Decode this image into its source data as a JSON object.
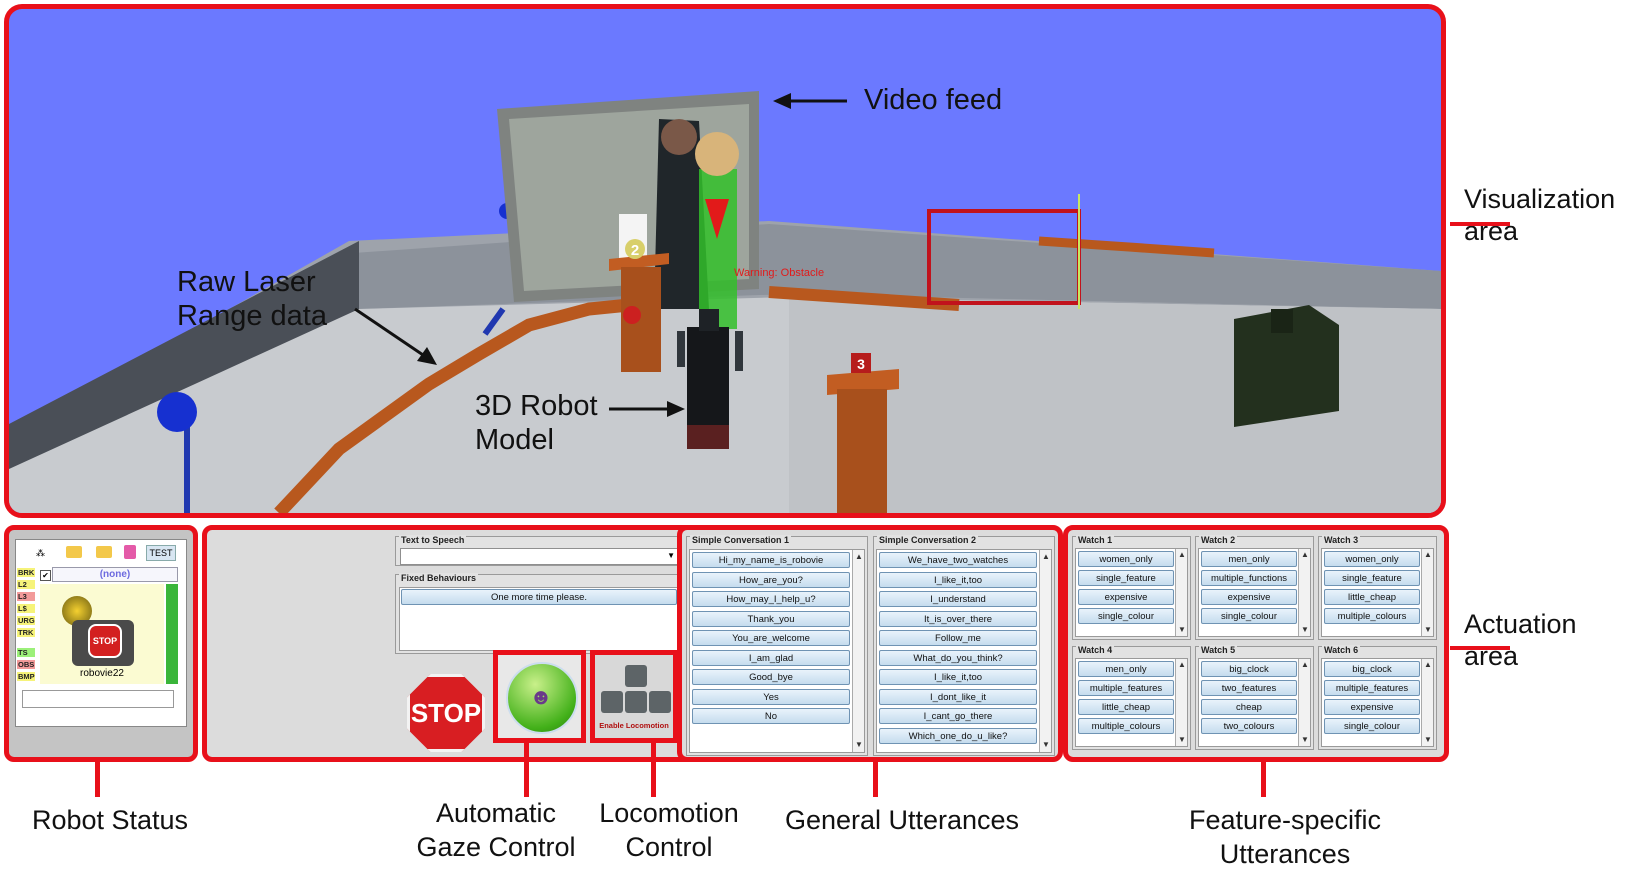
{
  "annotations": {
    "video_feed": "Video feed",
    "laser": [
      "Raw Laser",
      "Range data"
    ],
    "robot_model": [
      "3D Robot",
      "Model"
    ],
    "visualization": [
      "Visualization",
      "area"
    ],
    "actuation": [
      "Actuation",
      "area"
    ],
    "warning": "Warning: Obstacle",
    "marker_2": "2",
    "marker_3": "3"
  },
  "bottom_labels": {
    "robot_status": "Robot Status",
    "gaze": [
      "Automatic",
      "Gaze Control"
    ],
    "locomotion": [
      "Locomotion",
      "Control"
    ],
    "general": "General Utterances",
    "feature": "Feature-specific Utterances"
  },
  "robot_status": {
    "test_button": "TEST",
    "none_value": "(none)",
    "robot_name": "robovie22",
    "stop_sign": "STOP",
    "tags": [
      {
        "label": "BRK",
        "color": "#f6f37a"
      },
      {
        "label": "L2",
        "color": "#f6f37a"
      },
      {
        "label": "L3",
        "color": "#f29a9a"
      },
      {
        "label": "L$",
        "color": "#f6f37a"
      },
      {
        "label": "URG",
        "color": "#f6f37a"
      },
      {
        "label": "TRK",
        "color": "#f6f37a"
      },
      {
        "label": "TS",
        "color": "#9cf07a"
      },
      {
        "label": "OBS",
        "color": "#f29a9a"
      },
      {
        "label": "BMP",
        "color": "#f6f37a"
      }
    ]
  },
  "speech": {
    "tts_title": "Text to Speech",
    "fixed_title": "Fixed Behaviours",
    "fixed_item": "One more time please.",
    "stop_label": "STOP",
    "locomotion_label": "Enable Locomotion"
  },
  "conversations": [
    {
      "title": "Simple Conversation 1",
      "items": [
        "Hi_my_name_is_robovie",
        "How_are_you?",
        "How_may_I_help_u?",
        "Thank_you",
        "You_are_welcome",
        "I_am_glad",
        "Good_bye",
        "Yes",
        "No"
      ]
    },
    {
      "title": "Simple Conversation 2",
      "items": [
        "We_have_two_watches",
        "I_like_it,too",
        "I_understand",
        "It_is_over_there",
        "Follow_me",
        "What_do_you_think?",
        "I_like_it,too",
        "I_dont_like_it",
        "I_cant_go_there",
        "Which_one_do_u_like?"
      ]
    }
  ],
  "watches": [
    {
      "title": "Watch 1",
      "items": [
        "women_only",
        "single_feature",
        "expensive",
        "single_colour"
      ]
    },
    {
      "title": "Watch 2",
      "items": [
        "men_only",
        "multiple_functions",
        "expensive",
        "single_colour"
      ]
    },
    {
      "title": "Watch 3",
      "items": [
        "women_only",
        "single_feature",
        "little_cheap",
        "multiple_colours"
      ]
    },
    {
      "title": "Watch 4",
      "items": [
        "men_only",
        "multiple_features",
        "little_cheap",
        "multiple_colours"
      ]
    },
    {
      "title": "Watch 5",
      "items": [
        "big_clock",
        "two_features",
        "cheap",
        "two_colours"
      ]
    },
    {
      "title": "Watch 6",
      "items": [
        "big_clock",
        "multiple_features",
        "expensive",
        "single_colour"
      ]
    }
  ],
  "colors": {
    "accent_red": "#e8101a",
    "viz_sky": "#6b79ff",
    "laser": "#b8581e",
    "button_fill": "#d6e7f5"
  }
}
